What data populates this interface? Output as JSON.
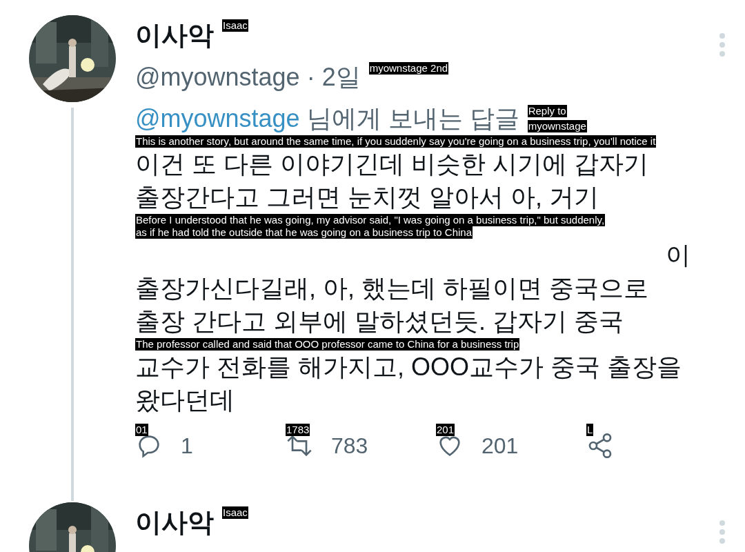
{
  "tweets": [
    {
      "name": "이사악",
      "name_overlay": "Isaac",
      "handle": "@myownstage",
      "time": "· 2일",
      "handle_overlay": "myownstage 2nd",
      "reply": {
        "handle": "@myownstage",
        "text": "님에게 보내는 답글",
        "overlays": [
          "Reply to",
          "myownstage"
        ]
      },
      "body": [
        {
          "kind": "line",
          "text": "이건 또 다른 이야기긴데 비슷한 시기에 갑자기",
          "overlays": [
            "This is another story, but around the same time, if you suddenly say you're going on a business trip, you'll notice it"
          ]
        },
        {
          "kind": "line",
          "text": "출장간다고 그러면 눈치껏 알아서 아, 거기"
        },
        {
          "kind": "tail",
          "text": "이",
          "overlays": [
            "Before I understood that he was going, my advisor said, \"I was going on a business trip,\" but suddenly,",
            "as if he had told the outside that he was going on a business trip to China"
          ]
        },
        {
          "kind": "line",
          "text": "출장가신다길래, 아, 했는데 하필이면 중국으로"
        },
        {
          "kind": "line",
          "text": "출장 간다고 외부에 말하셨던듯. 갑자기 중국"
        },
        {
          "kind": "line",
          "text": "교수가 전화를 해가지고, OOO교수가 중국 출장을",
          "overlays": [
            "The professor called and said that OOO professor came to China for a business trip"
          ]
        },
        {
          "kind": "line",
          "text": "왔다던데"
        }
      ],
      "actions": [
        {
          "kind": "reply",
          "count": "1",
          "overlay": "01"
        },
        {
          "kind": "retweet",
          "count": "783",
          "overlay": "1783"
        },
        {
          "kind": "like",
          "count": "201",
          "overlay": "201"
        },
        {
          "kind": "share",
          "overlay": "L"
        }
      ]
    },
    {
      "name": "이사악",
      "name_overlay": "Isaac"
    }
  ]
}
